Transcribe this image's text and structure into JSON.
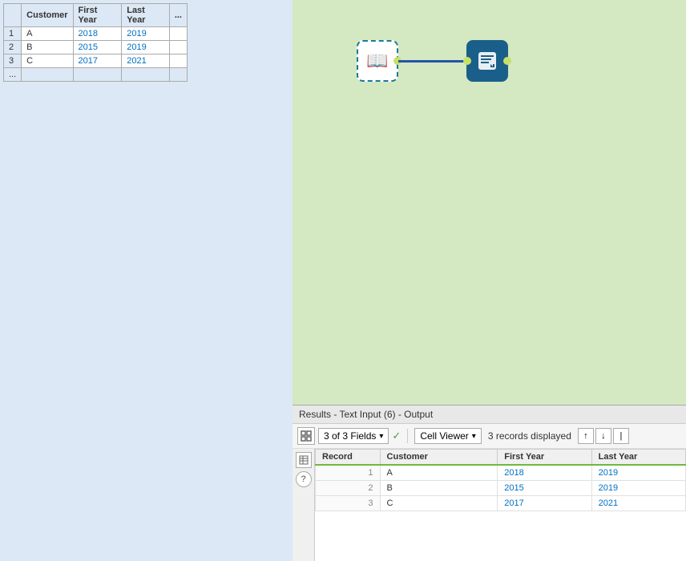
{
  "leftPanel": {
    "table": {
      "headers": [
        "",
        "Customer",
        "First Year",
        "Last Year",
        "..."
      ],
      "rows": [
        {
          "num": "1",
          "customer": "A",
          "firstYear": "2018",
          "lastYear": "2019"
        },
        {
          "num": "2",
          "customer": "B",
          "firstYear": "2015",
          "lastYear": "2019"
        },
        {
          "num": "3",
          "customer": "C",
          "firstYear": "2017",
          "lastYear": "2021"
        }
      ]
    }
  },
  "canvas": {
    "nodes": [
      {
        "id": "input-node",
        "type": "book",
        "icon": "📖"
      },
      {
        "id": "output-node",
        "type": "output",
        "icon": "⬇"
      }
    ]
  },
  "resultsPanel": {
    "title": "Results - Text Input (6) - Output",
    "toolbar": {
      "fieldsLabel": "3 of 3 Fields",
      "cellViewerLabel": "Cell Viewer",
      "recordsCount": "3 records displayed"
    },
    "table": {
      "headers": [
        "Record",
        "Customer",
        "First Year",
        "Last Year"
      ],
      "rows": [
        {
          "num": "1",
          "customer": "A",
          "firstYear": "2018",
          "lastYear": "2019"
        },
        {
          "num": "2",
          "customer": "B",
          "firstYear": "2015",
          "lastYear": "2019"
        },
        {
          "num": "3",
          "customer": "C",
          "firstYear": "2017",
          "lastYear": "2021"
        }
      ]
    }
  }
}
